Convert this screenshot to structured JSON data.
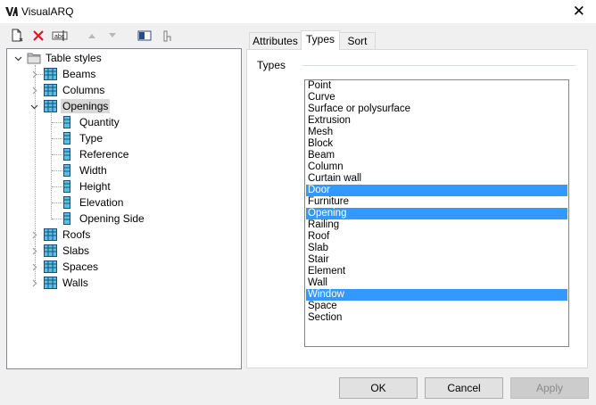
{
  "window": {
    "title": "VisualARQ"
  },
  "toolbar": {
    "icons": [
      "new-document-icon",
      "delete-icon",
      "rename-icon",
      "move-up-icon",
      "move-down-icon",
      "toggle-panel-icon",
      "pointer-icon"
    ]
  },
  "tree": {
    "root": "Table styles",
    "items": [
      {
        "label": "Beams"
      },
      {
        "label": "Columns"
      },
      {
        "label": "Openings",
        "selected": true,
        "children": [
          "Quantity",
          "Type",
          "Reference",
          "Width",
          "Height",
          "Elevation",
          "Opening Side"
        ]
      },
      {
        "label": "Roofs"
      },
      {
        "label": "Slabs"
      },
      {
        "label": "Spaces"
      },
      {
        "label": "Walls"
      }
    ]
  },
  "tabs": [
    {
      "label": "Attributes"
    },
    {
      "label": "Types",
      "active": true
    },
    {
      "label": "Sort"
    }
  ],
  "types_panel": {
    "group_label": "Types",
    "items": [
      {
        "label": "Point",
        "selected": false
      },
      {
        "label": "Curve",
        "selected": false
      },
      {
        "label": "Surface or polysurface",
        "selected": false
      },
      {
        "label": "Extrusion",
        "selected": false
      },
      {
        "label": "Mesh",
        "selected": false
      },
      {
        "label": "Block",
        "selected": false
      },
      {
        "label": "Beam",
        "selected": false
      },
      {
        "label": "Column",
        "selected": false
      },
      {
        "label": "Curtain wall",
        "selected": false
      },
      {
        "label": "Door",
        "selected": true
      },
      {
        "label": "Furniture",
        "selected": false
      },
      {
        "label": "Opening",
        "selected": true
      },
      {
        "label": "Railing",
        "selected": false
      },
      {
        "label": "Roof",
        "selected": false
      },
      {
        "label": "Slab",
        "selected": false
      },
      {
        "label": "Stair",
        "selected": false
      },
      {
        "label": "Element",
        "selected": false
      },
      {
        "label": "Wall",
        "selected": false
      },
      {
        "label": "Window",
        "selected": true
      },
      {
        "label": "Space",
        "selected": false
      },
      {
        "label": "Section",
        "selected": false
      }
    ]
  },
  "buttons": {
    "ok": "OK",
    "cancel": "Cancel",
    "apply": "Apply"
  },
  "colors": {
    "selection": "#3399ff",
    "tree_selection": "#d9d9d9",
    "delete_red": "#e81123"
  }
}
